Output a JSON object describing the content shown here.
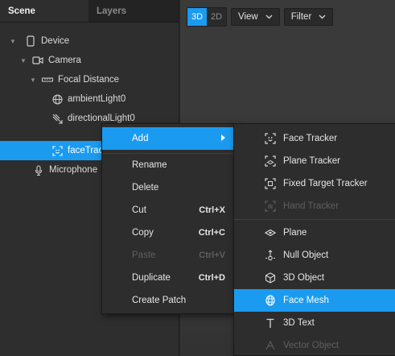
{
  "panel": {
    "tabs": [
      "Scene",
      "Layers"
    ],
    "tree": [
      {
        "label": "Device",
        "icon": "device-icon",
        "arrow": "▼"
      },
      {
        "label": "Camera",
        "icon": "camera-icon",
        "arrow": "▼"
      },
      {
        "label": "Focal Distance",
        "icon": "focal-distance-icon",
        "arrow": "▼"
      },
      {
        "label": "ambientLight0",
        "icon": "ambient-light-icon",
        "arrow": ""
      },
      {
        "label": "directionalLight0",
        "icon": "directional-light-icon",
        "arrow": ""
      },
      {
        "label": "faceTrac",
        "icon": "face-tracker-icon",
        "arrow": ""
      },
      {
        "label": "Microphone",
        "icon": "microphone-icon",
        "arrow": ""
      }
    ]
  },
  "viewport": {
    "mode_3d": "3D",
    "mode_2d": "2D",
    "view_label": "View",
    "filter_label": "Filter"
  },
  "context_menu": {
    "add": "Add",
    "rename": "Rename",
    "delete": "Delete",
    "cut": "Cut",
    "cut_shortcut": "Ctrl+X",
    "copy": "Copy",
    "copy_shortcut": "Ctrl+C",
    "paste": "Paste",
    "paste_shortcut": "Ctrl+V",
    "duplicate": "Duplicate",
    "duplicate_shortcut": "Ctrl+D",
    "create_patch": "Create Patch"
  },
  "add_submenu": {
    "items": [
      {
        "label": "Face Tracker",
        "icon": "face-tracker-icon"
      },
      {
        "label": "Plane Tracker",
        "icon": "plane-tracker-icon"
      },
      {
        "label": "Fixed Target Tracker",
        "icon": "fixed-target-tracker-icon"
      },
      {
        "label": "Hand Tracker",
        "icon": "hand-tracker-icon"
      },
      {
        "label": "Plane",
        "icon": "plane-icon"
      },
      {
        "label": "Null Object",
        "icon": "null-object-icon"
      },
      {
        "label": "3D Object",
        "icon": "3d-object-icon"
      },
      {
        "label": "Face Mesh",
        "icon": "face-mesh-icon"
      },
      {
        "label": "3D Text",
        "icon": "3d-text-icon"
      },
      {
        "label": "Vector Object",
        "icon": "vector-object-icon"
      }
    ]
  },
  "colors": {
    "accent": "#1a9bf0",
    "panel_bg": "#2e2e2e",
    "menu_bg": "#2d2d2d",
    "disabled_text": "#5f5f5f"
  }
}
